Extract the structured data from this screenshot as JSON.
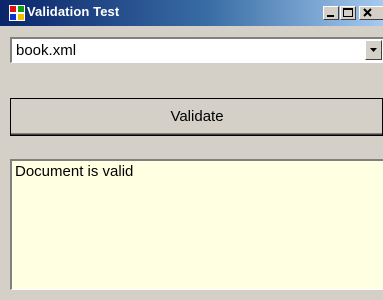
{
  "window": {
    "title": "Validation Test",
    "app_icon": "windows-app-icon",
    "controls": {
      "minimize": "minimize-icon",
      "maximize": "maximize-icon",
      "close": "close-icon"
    }
  },
  "file_select": {
    "value": "book.xml",
    "arrow_icon": "chevron-down-icon"
  },
  "validate_button": {
    "label": "Validate"
  },
  "output": {
    "text": "Document is valid"
  },
  "colors": {
    "face": "#d4d0c8",
    "title_start": "#0a246a",
    "title_end": "#a6caf0",
    "output_background": "#ffffe1"
  }
}
